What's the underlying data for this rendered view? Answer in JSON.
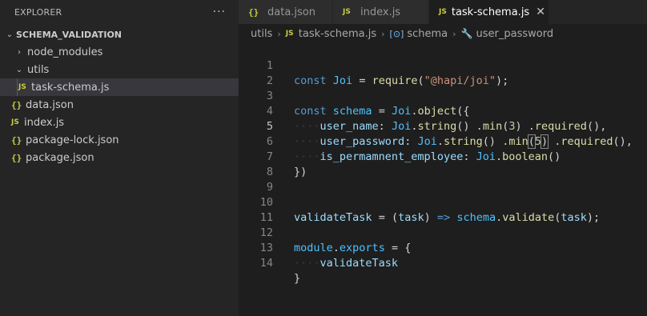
{
  "sidebar": {
    "title": "EXPLORER",
    "more_icon": "ellipsis-icon",
    "section": "SCHEMA_VALIDATION",
    "items": [
      {
        "label": "node_modules",
        "type": "folder",
        "expanded": false
      },
      {
        "label": "utils",
        "type": "folder",
        "expanded": true
      },
      {
        "label": "task-schema.js",
        "type": "js",
        "selected": true
      },
      {
        "label": "data.json",
        "type": "json"
      },
      {
        "label": "index.js",
        "type": "js"
      },
      {
        "label": "package-lock.json",
        "type": "json"
      },
      {
        "label": "package.json",
        "type": "json"
      }
    ]
  },
  "tabs": [
    {
      "label": "data.json",
      "icon": "{}",
      "active": false
    },
    {
      "label": "index.js",
      "icon": "JS",
      "active": false
    },
    {
      "label": "task-schema.js",
      "icon": "JS",
      "active": true
    }
  ],
  "breadcrumb": {
    "folder": "utils",
    "file": "task-schema.js",
    "symbol": "schema",
    "property": "user_password"
  },
  "icons": {
    "js": "JS",
    "json": "{}",
    "chevron_right": "›",
    "chevron_down": "⌄"
  },
  "editor": {
    "current_line": 5,
    "lines": [
      {
        "n": "1"
      },
      {
        "n": "2"
      },
      {
        "n": "3"
      },
      {
        "n": "4"
      },
      {
        "n": "5"
      },
      {
        "n": "6"
      },
      {
        "n": "7"
      },
      {
        "n": "8"
      },
      {
        "n": "9"
      },
      {
        "n": "10"
      },
      {
        "n": "11"
      },
      {
        "n": "12"
      },
      {
        "n": "13"
      },
      {
        "n": "14"
      }
    ],
    "code": {
      "l1": [
        "const",
        "Joi",
        "=",
        "require",
        "(",
        "\"@hapi/joi\"",
        ");"
      ],
      "l3": [
        "const",
        "schema",
        "=",
        "Joi",
        ".",
        "object",
        "({"
      ],
      "l4": [
        "user_name",
        ":",
        "Joi",
        ".",
        "string",
        "()",
        ".",
        "min",
        "(",
        "3",
        ")",
        ".",
        "required",
        "(),"
      ],
      "l5": [
        "user_password",
        ":",
        "Joi",
        ".",
        "string",
        "()",
        ".",
        "min",
        "(",
        "5",
        ")",
        ".",
        "required",
        "(),"
      ],
      "l6": [
        "is_permamnent_employee",
        ":",
        "Joi",
        ".",
        "boolean",
        "()"
      ],
      "l7": [
        "})"
      ],
      "l10": [
        "validateTask",
        "=",
        "(",
        "task",
        ")",
        "=>",
        "schema",
        ".",
        "validate",
        "(",
        "task",
        ");"
      ],
      "l12": [
        "module",
        ".",
        "exports",
        "=",
        "{"
      ],
      "l13": [
        "validateTask"
      ],
      "l14": [
        "}"
      ]
    }
  },
  "colors": {
    "editor_bg": "#1e1e1e",
    "sidebar_bg": "#252526",
    "keyword": "#569cd6",
    "string": "#ce9178",
    "function": "#dcdcaa",
    "variable": "#4fc1ff",
    "property": "#9cdcfe",
    "number": "#b5cea8",
    "js_icon": "#cbcb41"
  }
}
